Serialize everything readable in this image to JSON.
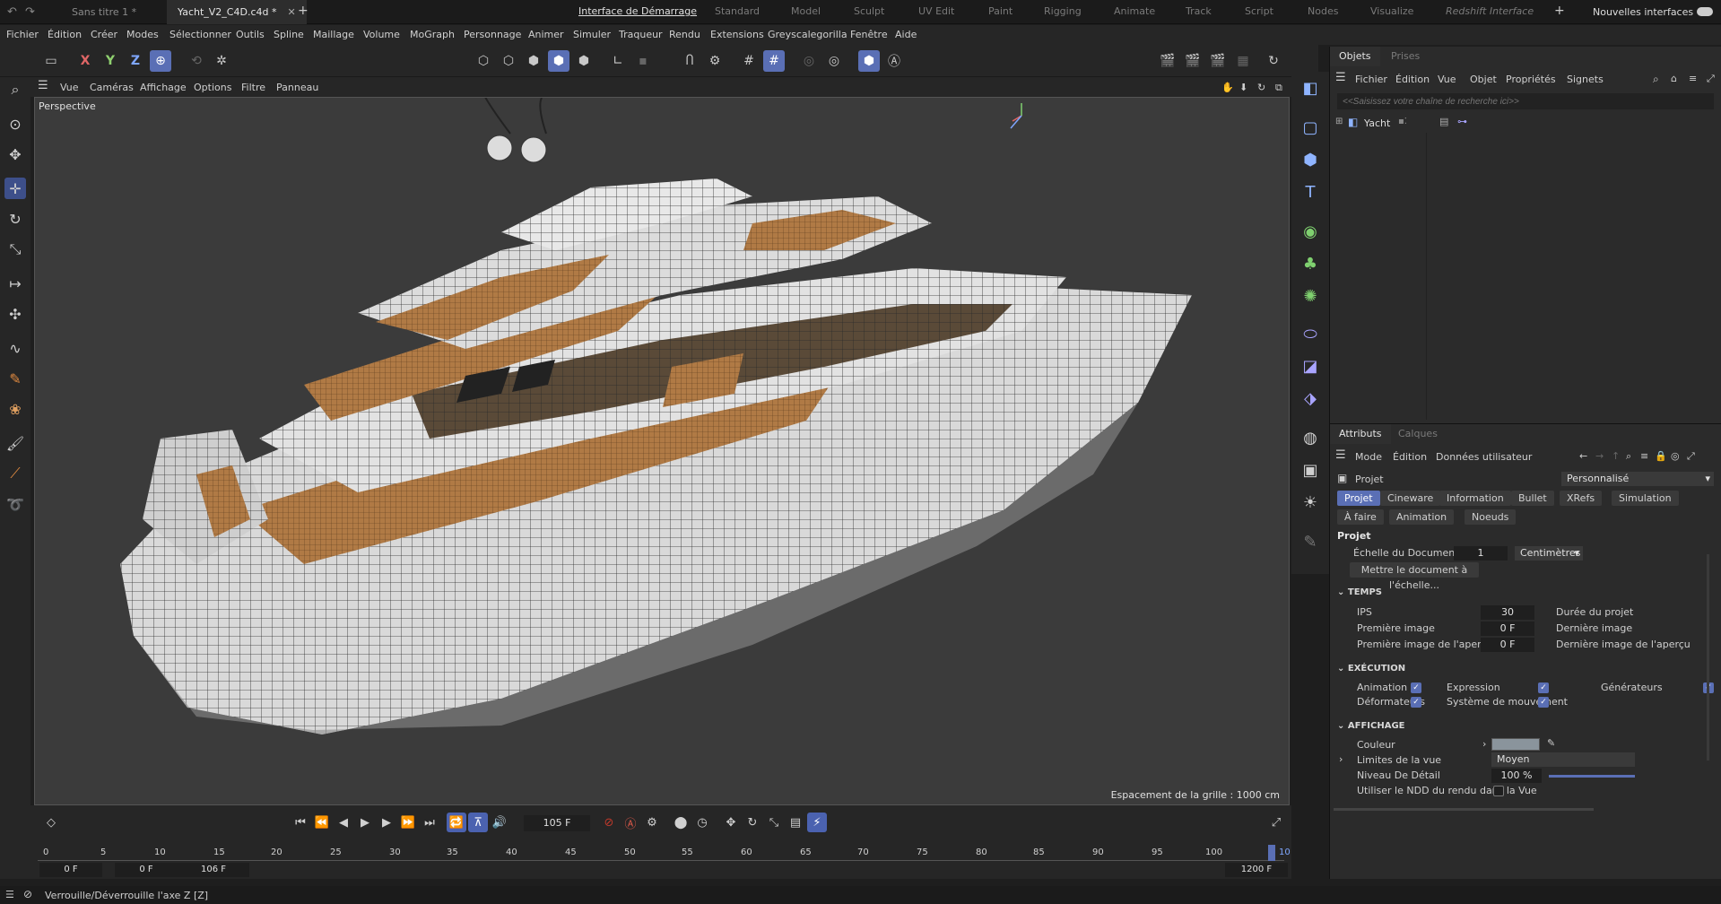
{
  "doc_tabs": {
    "tab1": "Sans titre 1 *",
    "tab2": "Yacht_V2_C4D.c4d *",
    "add": "+"
  },
  "layouts": [
    "Interface de Démarrage",
    "Standard",
    "Model",
    "Sculpt",
    "UV Edit",
    "Paint",
    "Rigging",
    "Animate",
    "Track",
    "Script",
    "Nodes",
    "Visualize",
    "Redshift Interface"
  ],
  "layouts_add": "+",
  "new_interfaces": "Nouvelles interfaces",
  "menu": [
    "Fichier",
    "Édition",
    "Créer",
    "Modes",
    "Sélectionner",
    "Outils",
    "Spline",
    "Maillage",
    "Volume",
    "MoGraph",
    "Personnage",
    "Animer",
    "Simuler",
    "Traqueur",
    "Rendu",
    "Extensions",
    "Greyscalegorilla",
    "Fenêtre",
    "Aide"
  ],
  "axes": {
    "x": "X",
    "y": "Y",
    "z": "Z"
  },
  "viewport_menu": [
    "Vue",
    "Caméras",
    "Affichage",
    "Options",
    "Filtre",
    "Panneau"
  ],
  "viewport": {
    "label": "Perspective",
    "grid": "Espacement de la grille : 1000 cm"
  },
  "objects_panel": {
    "tab_objects": "Objets",
    "tab_takes": "Prises",
    "menu": [
      "Fichier",
      "Édition",
      "Vue",
      "Objet",
      "Propriétés",
      "Signets"
    ],
    "search_placeholder": "<<Saisissez votre chaîne de recherche ici>>",
    "object_name": "Yacht"
  },
  "attributes": {
    "tab_attrs": "Attributs",
    "tab_layers": "Calques",
    "menu": [
      "Mode",
      "Édition",
      "Données utilisateur"
    ],
    "project_label": "Projet",
    "preset": "Personnalisé",
    "tabs_row1": [
      "Projet",
      "Cineware",
      "Information",
      "Bullet",
      "XRefs",
      "Simulation"
    ],
    "tabs_row2": [
      "À faire",
      "Animation",
      "Noeuds"
    ],
    "section_title": "Projet",
    "doc_scale_label": "Échelle du Document",
    "doc_scale_value": "1",
    "doc_scale_unit": "Centimètres",
    "scale_button": "Mettre le document à l'échelle...",
    "time": {
      "header": "TEMPS",
      "fps_label": "IPS",
      "fps": "30",
      "first_label": "Première image",
      "first": "0 F",
      "preview_first_label": "Première image de l'aperçu",
      "preview_first": "0 F",
      "duration_label": "Durée du projet",
      "last_label": "Dernière image",
      "preview_last_label": "Dernière image de l'aperçu"
    },
    "exec": {
      "header": "EXÉCUTION",
      "animation": "Animation",
      "expression": "Expression",
      "generators": "Générateurs",
      "deformers": "Déformateurs",
      "motion": "Système de mouvement"
    },
    "display": {
      "header": "AFFICHAGE",
      "color_label": "Couleur",
      "view_limits_label": "Limites de la vue",
      "view_limits": "Moyen",
      "lod_label": "Niveau De Détail",
      "lod": "100 %",
      "render_lod_label": "Utiliser le NDD du rendu dans la Vue"
    },
    "swatch_color": "#8a949c"
  },
  "timeline": {
    "current_frame": "105 F",
    "ticks": [
      "0",
      "5",
      "10",
      "15",
      "20",
      "25",
      "30",
      "35",
      "40",
      "45",
      "50",
      "55",
      "60",
      "65",
      "70",
      "75",
      "80",
      "85",
      "90",
      "95",
      "100"
    ],
    "end_tick": "10",
    "start": "0 F",
    "range_start": "0 F",
    "range_end": "106 F",
    "end": "1200 F"
  },
  "status": {
    "text": "Verrouille/Déverrouille l'axe Z [Z]"
  },
  "colors": {
    "accent": "#5a6fb5",
    "wood": "#b07a45"
  }
}
